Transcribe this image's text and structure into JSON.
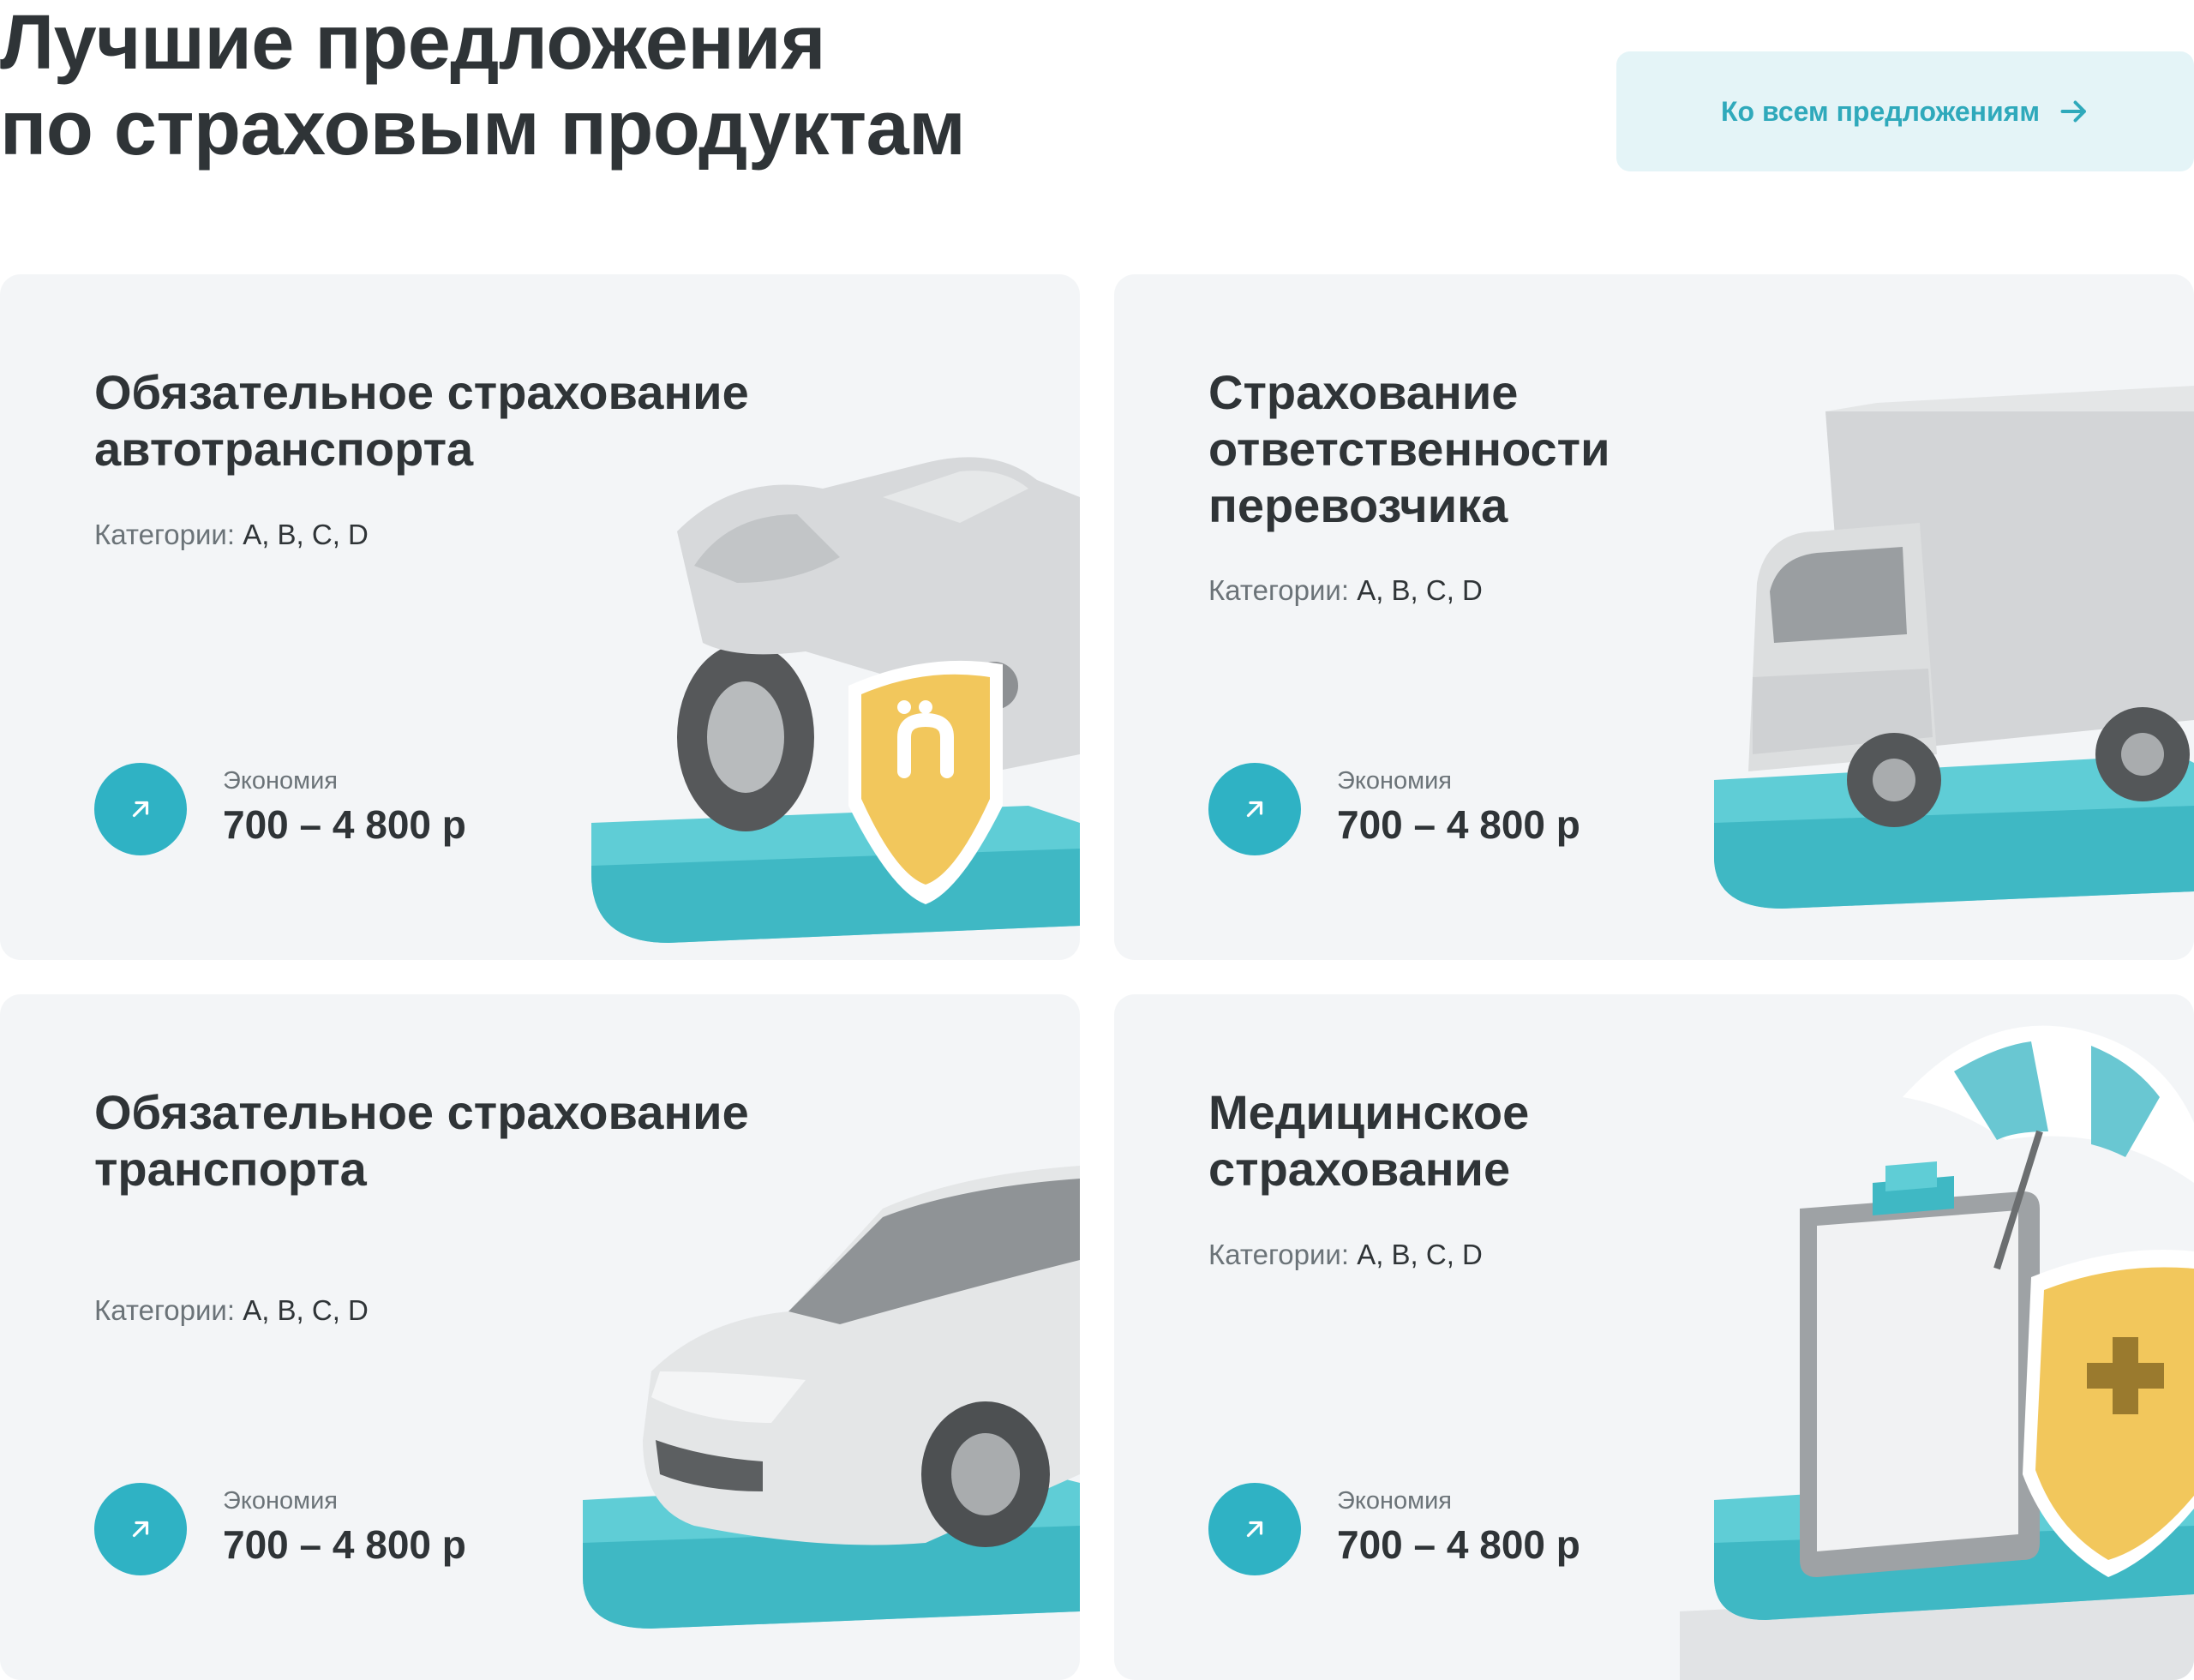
{
  "header": {
    "title_line1": "Лучшие предложения",
    "title_line2": "по страховым продуктам",
    "all_offers_label": "Ко всем предложениям"
  },
  "cards": [
    {
      "title_lines": [
        "Обязательное страхование",
        "автотранспорта"
      ],
      "categories_label": "Категории:",
      "categories_value": "A, B, C, D",
      "saving_label": "Экономия",
      "saving_value": "700 – 4 800 р",
      "icon": "motorcycle-shield"
    },
    {
      "title_lines": [
        "Страхование",
        "ответственности",
        "перевозчика"
      ],
      "categories_label": "Категории:",
      "categories_value": "A, B, C, D",
      "saving_label": "Экономия",
      "saving_value": "700 – 4 800 р",
      "icon": "truck"
    },
    {
      "title_lines": [
        "Обязательное страхование",
        "транспорта"
      ],
      "categories_label": "Категории:",
      "categories_value": "A, B, C, D",
      "saving_label": "Экономия",
      "saving_value": "700 – 4 800 р",
      "icon": "car"
    },
    {
      "title_lines": [
        "Медицинское",
        "страхование"
      ],
      "categories_label": "Категории:",
      "categories_value": "A, B, C, D",
      "saving_label": "Экономия",
      "saving_value": "700 – 4 800 р",
      "icon": "clipboard-umbrella-shield"
    }
  ],
  "colors": {
    "accent": "#2fb2c4",
    "card_bg": "#f3f5f7",
    "button_bg": "#e4f4f7",
    "title": "#2f3437",
    "muted": "#6b7378",
    "platform": "#5fcdd6",
    "shield": "#f2c75c"
  }
}
